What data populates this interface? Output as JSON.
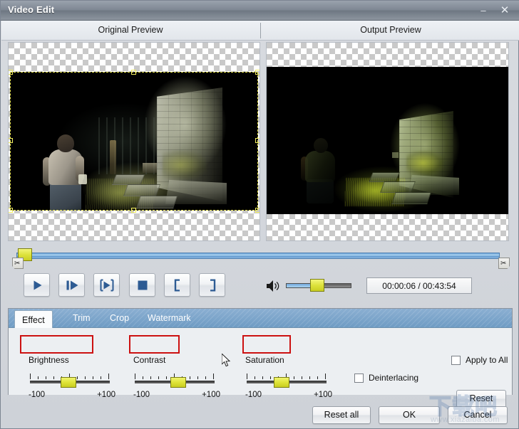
{
  "window": {
    "title": "Video Edit",
    "minimize_label": "–",
    "close_label": "✕"
  },
  "preview": {
    "original_label": "Original Preview",
    "output_label": "Output Preview"
  },
  "timeline": {
    "trim_start_icon": "scissors-icon",
    "trim_end_icon": "scissors-icon",
    "position_percent": 1
  },
  "transport": {
    "buttons": [
      {
        "name": "play-button",
        "icon": "play-icon"
      },
      {
        "name": "play-selection-button",
        "icon": "play-pause-icon"
      },
      {
        "name": "next-frame-button",
        "icon": "frame-advance-icon"
      },
      {
        "name": "stop-button",
        "icon": "stop-icon"
      },
      {
        "name": "set-in-point-button",
        "icon": "bracket-left-icon"
      },
      {
        "name": "set-out-point-button",
        "icon": "bracket-right-icon"
      }
    ],
    "volume_icon": "speaker-icon",
    "volume_percent": 40,
    "time_display": "00:00:06 / 00:43:54"
  },
  "tabs": [
    {
      "label": "Effect",
      "active": true
    },
    {
      "label": "Trim",
      "active": false
    },
    {
      "label": "Crop",
      "active": false
    },
    {
      "label": "Watermark",
      "active": false
    }
  ],
  "effect": {
    "sliders": [
      {
        "label": "Brightness",
        "min_label": "-100",
        "max_label": "+100",
        "value": 0,
        "value_percent": 50,
        "highlighted": true
      },
      {
        "label": "Contrast",
        "min_label": "-100",
        "max_label": "+100",
        "value": 12,
        "value_percent": 56,
        "highlighted": true
      },
      {
        "label": "Saturation",
        "min_label": "-100",
        "max_label": "+100",
        "value": -10,
        "value_percent": 45,
        "highlighted": true
      }
    ],
    "deinterlacing": {
      "label": "Deinterlacing",
      "checked": false
    },
    "apply_to_all": {
      "label": "Apply to All",
      "checked": false
    },
    "reset_label": "Reset"
  },
  "footer": {
    "reset_all_label": "Reset all",
    "ok_label": "OK",
    "cancel_label": "Cancel"
  },
  "watermark": {
    "logo_text": "下载吧",
    "url_text": "www.xiazaiba.com"
  },
  "colors": {
    "titlebar": "#7e8793",
    "tabstrip_blue": "#6f9cc4",
    "highlight_red": "#cc1111",
    "slider_thumb_yellow": "#dfe43a",
    "timeline_blue": "#6ea4d8",
    "panel_bg": "#eceff2"
  }
}
